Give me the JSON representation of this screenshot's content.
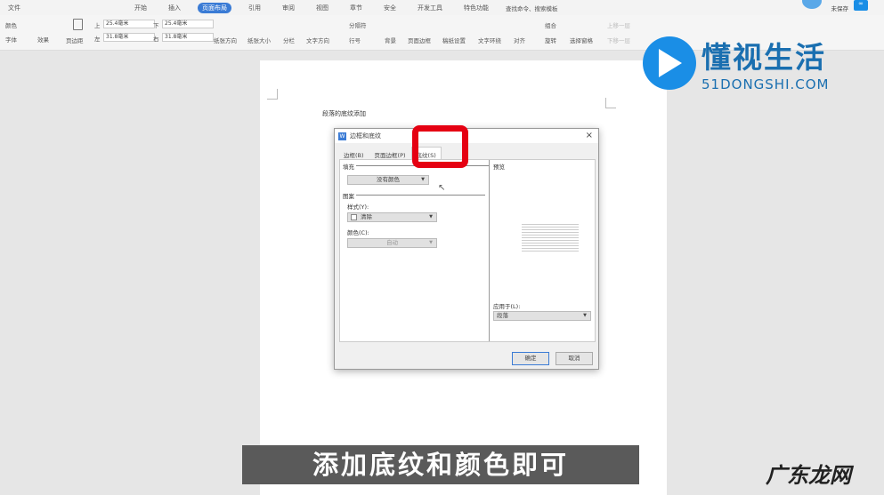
{
  "menu": {
    "file": "文件",
    "tabs": [
      "开始",
      "插入",
      "页面布局",
      "引用",
      "审阅",
      "视图",
      "章节",
      "安全",
      "开发工具",
      "特色功能"
    ],
    "active_tab": "页面布局",
    "search": "查找命令、搜索模板",
    "save_status": "未保存"
  },
  "ribbon": {
    "color": "颜色",
    "font": "字体",
    "effect": "效果",
    "margins": "页边距",
    "top_label": "上",
    "top": "25.4毫米",
    "bottom_label": "下",
    "bottom": "25.4毫米",
    "left_label": "左",
    "left": "31.8毫米",
    "right_label": "右",
    "right": "31.8毫米",
    "orientation": "纸张方向",
    "size": "纸张大小",
    "columns": "分栏",
    "text_direction": "文字方向",
    "breaks": "分隔符",
    "line_numbers": "行号",
    "background": "背景",
    "page_border": "页面边框",
    "manuscript": "稿纸设置",
    "wrap": "文字环绕",
    "align": "对齐",
    "group": "组合",
    "rotate": "旋转",
    "selection_pane": "选择窗格",
    "bring_forward": "上移一层",
    "send_backward": "下移一层"
  },
  "document": {
    "paragraph": "段落的底纹添加"
  },
  "dialog": {
    "title": "边框和底纹",
    "tabs": [
      "边框(B)",
      "页面边框(P)",
      "底纹(S)"
    ],
    "fill_label": "填充",
    "fill_value": "没有颜色",
    "pattern_label": "图案",
    "style_label": "样式(Y):",
    "style_value": "清除",
    "color_label": "颜色(C):",
    "color_value": "自动",
    "preview_label": "预览",
    "apply_label": "应用于(L):",
    "apply_value": "段落",
    "ok": "确定",
    "cancel": "取消"
  },
  "subtitle": "添加底纹和颜色即可",
  "watermark": {
    "brand": "懂视生活",
    "domain": "51DONGSHI.COM",
    "corner": "广东龙网"
  }
}
